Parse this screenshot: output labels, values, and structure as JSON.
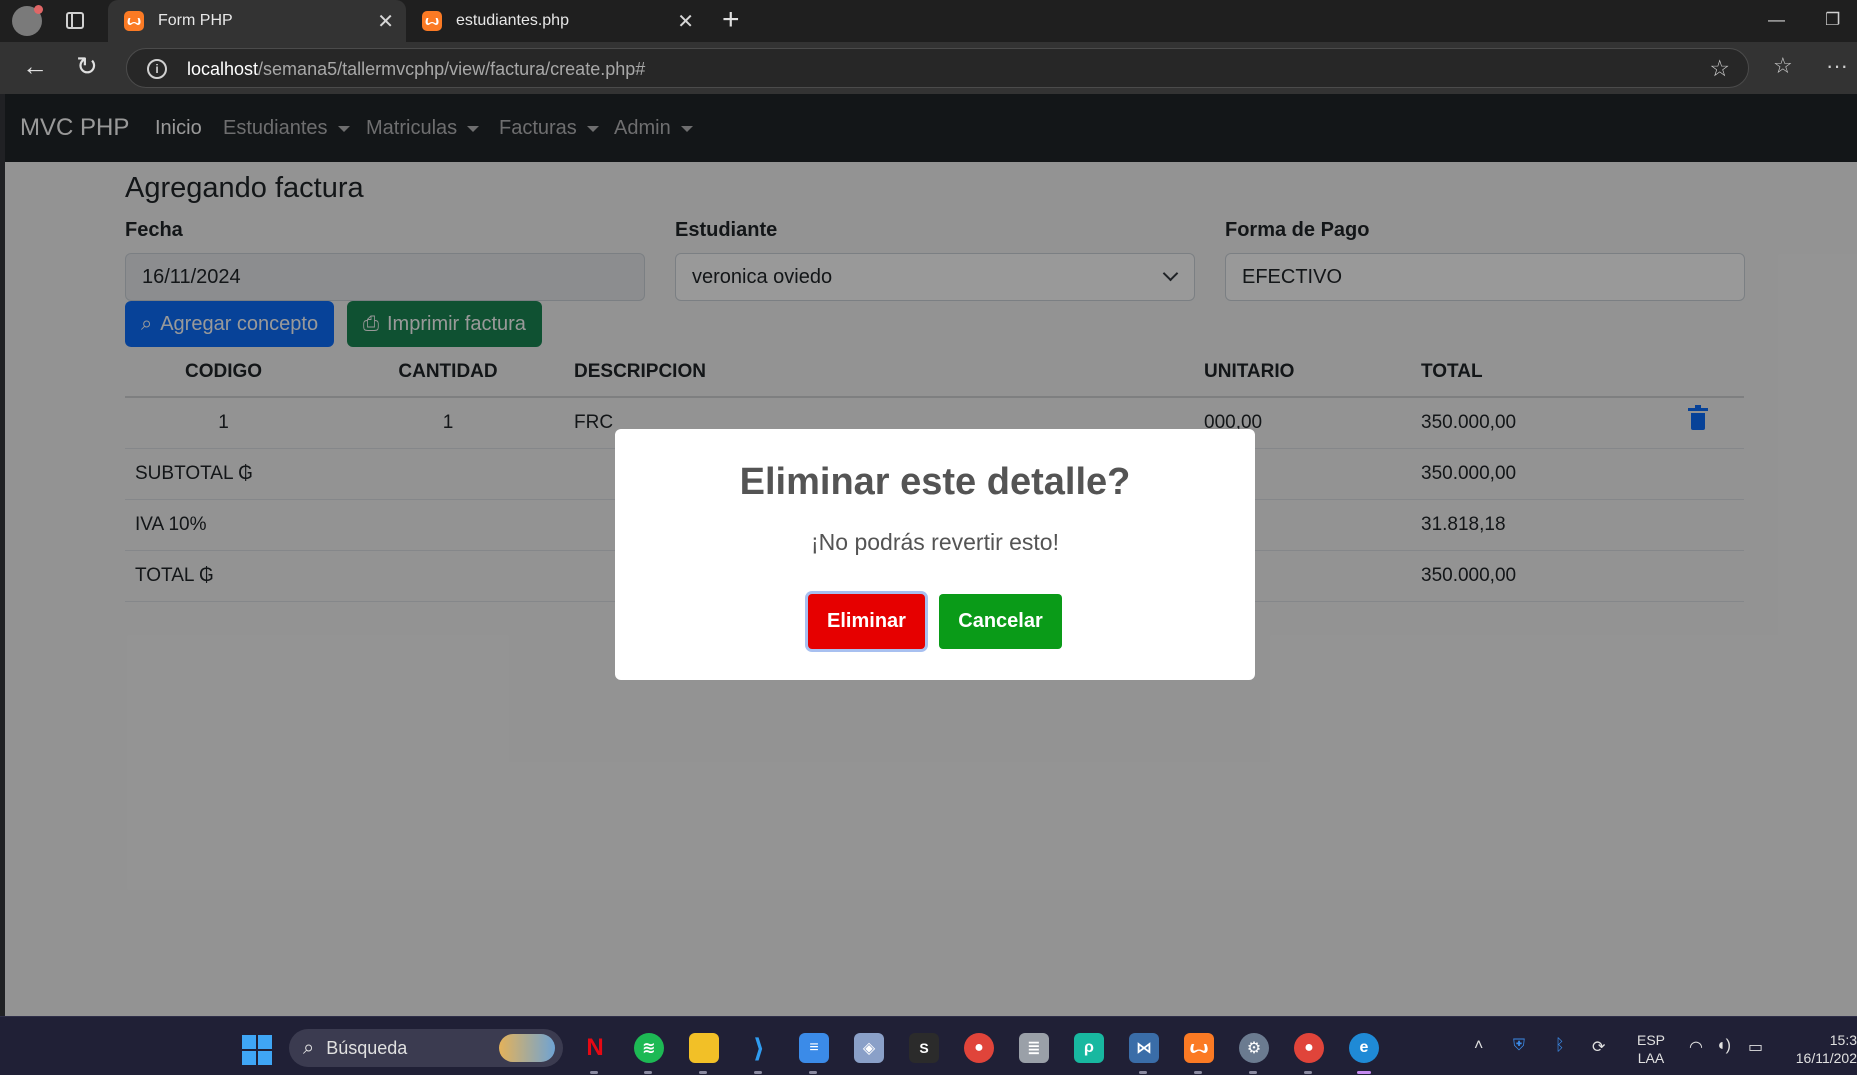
{
  "browser": {
    "tabs": [
      {
        "title": "Form PHP",
        "icon": "xampp-icon"
      },
      {
        "title": "estudiantes.php",
        "icon": "xampp-icon"
      }
    ],
    "url_host": "localhost",
    "url_path": "/semana5/tallermvcphp/view/factura/create.php#"
  },
  "navbar": {
    "brand": "MVC PHP",
    "links": [
      "Inicio",
      "Estudiantes",
      "Matriculas",
      "Facturas",
      "Admin"
    ]
  },
  "form": {
    "title": "Agregando factura",
    "fecha_label": "Fecha",
    "fecha_value": "16/11/2024",
    "estudiante_label": "Estudiante",
    "estudiante_value": "veronica oviedo",
    "forma_pago_label": "Forma de Pago",
    "forma_pago_value": "EFECTIVO",
    "add_concept_label": "Agregar concepto",
    "print_label": "Imprimir factura"
  },
  "table": {
    "headers": [
      "CODIGO",
      "CANTIDAD",
      "DESCRIPCION",
      "UNITARIO",
      "TOTAL"
    ],
    "rows": [
      {
        "codigo": "1",
        "cantidad": "1",
        "descripcion": "FRC",
        "unitario": "000,00",
        "total": "350.000,00"
      }
    ],
    "subtotal_label": "SUBTOTAL ₲",
    "subtotal_value": "350.000,00",
    "iva_label": "IVA 10%",
    "iva_value": "31.818,18",
    "total_label": "TOTAL ₲",
    "total_value": "350.000,00"
  },
  "modal": {
    "title": "Eliminar este detalle?",
    "text": "¡No podrás revertir esto!",
    "confirm_label": "Eliminar",
    "cancel_label": "Cancelar"
  },
  "taskbar": {
    "search_placeholder": "Búsqueda",
    "lang_line1": "ESP",
    "lang_line2": "LAA",
    "time": "15:3",
    "date": "16/11/202"
  },
  "colors": {
    "primary": "#0d6efd",
    "success": "#198754",
    "danger_confirm": "#e60000",
    "cancel": "#0a9b18"
  }
}
